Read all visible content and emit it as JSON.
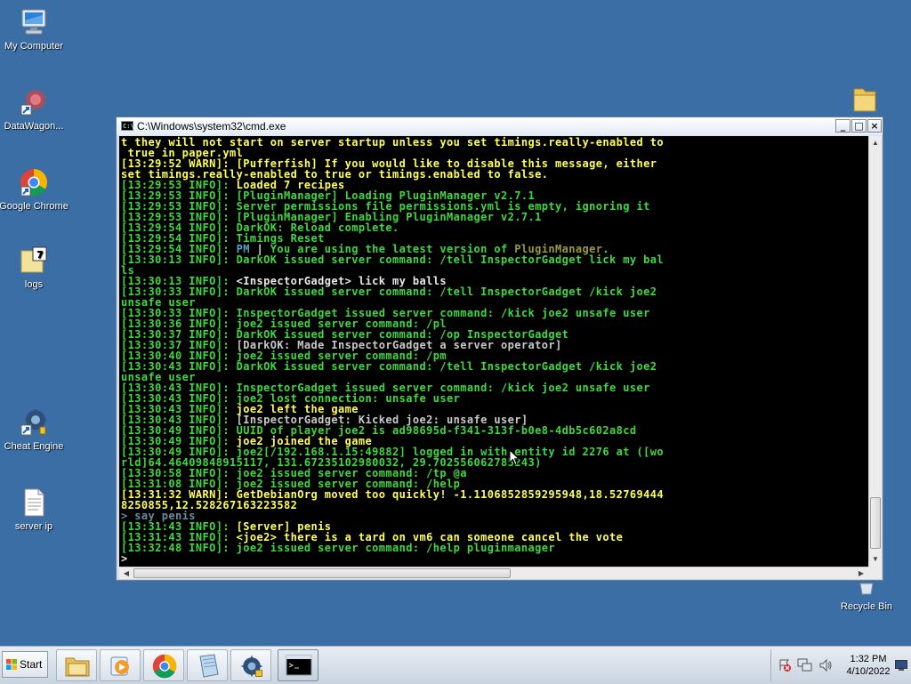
{
  "desktop": {
    "icons": [
      {
        "label": "My Computer",
        "icon": "computer-icon"
      },
      {
        "label": "DataWagon...",
        "icon": "shortcut-icon"
      },
      {
        "label": "Google Chrome",
        "icon": "chrome-icon"
      },
      {
        "label": "logs",
        "icon": "notepad-file-icon"
      },
      {
        "label": "Cheat Engine",
        "icon": "cheat-engine-icon"
      },
      {
        "label": "server ip",
        "icon": "text-file-icon"
      },
      {
        "label": "Recycle Bin",
        "icon": "recycle-bin-icon"
      },
      {
        "label": "",
        "icon": "folder-icon"
      }
    ]
  },
  "window": {
    "title": "C:\\Windows\\system32\\cmd.exe",
    "appicon_text": "C:\\",
    "minimize": "_",
    "maximize": "□",
    "close": "×"
  },
  "console": {
    "lines": [
      [
        {
          "t": "t they will not start on server startup unless you set timings.really-enabled to",
          "c": "y"
        }
      ],
      [
        {
          "t": " true in paper.yml",
          "c": "y"
        }
      ],
      [
        {
          "t": "[13:29:52 WARN]: [Pufferfish] If you would like to disable this message, either",
          "c": "y"
        }
      ],
      [
        {
          "t": "set timings.really-enabled to true or timings.enabled to false.",
          "c": "y"
        }
      ],
      [
        {
          "t": "[13:29:53 INFO]: ",
          "c": "g"
        },
        {
          "t": "Loaded 7 recipes",
          "c": "y"
        }
      ],
      [
        {
          "t": "[13:29:53 INFO]: [PluginManager] Loading PluginManager v2.7.1",
          "c": "g"
        }
      ],
      [
        {
          "t": "[13:29:53 INFO]: Server permissions file permissions.yml is empty, ignoring it",
          "c": "g"
        }
      ],
      [
        {
          "t": "[13:29:53 INFO]: [PluginManager] Enabling PluginManager v2.7.1",
          "c": "g"
        }
      ],
      [
        {
          "t": "[13:29:54 INFO]: DarkOK: Reload complete.",
          "c": "g"
        }
      ],
      [
        {
          "t": "[13:29:54 INFO]: Timings Reset",
          "c": "g"
        }
      ],
      [
        {
          "t": "[13:29:54 INFO]: ",
          "c": "g"
        },
        {
          "t": "PM",
          "c": "b"
        },
        {
          "t": " | ",
          "c": "w"
        },
        {
          "t": "You are using the latest version of ",
          "c": "g"
        },
        {
          "t": "PluginManager",
          "c": "o"
        },
        {
          "t": ".",
          "c": "g"
        }
      ],
      [
        {
          "t": "[13:30:13 INFO]: DarkOK issued server command: /tell InspectorGadget lick my bal",
          "c": "g"
        }
      ],
      [
        {
          "t": "ls",
          "c": "g"
        }
      ],
      [
        {
          "t": "[13:30:13 INFO]: ",
          "c": "g"
        },
        {
          "t": "<InspectorGadget> lick my balls",
          "c": "w"
        }
      ],
      [
        {
          "t": "[13:30:33 INFO]: DarkOK issued server command: /tell InspectorGadget /kick joe2",
          "c": "g"
        }
      ],
      [
        {
          "t": "unsafe user",
          "c": "g"
        }
      ],
      [
        {
          "t": "[13:30:33 INFO]: InspectorGadget issued server command: /kick joe2 unsafe user",
          "c": "g"
        }
      ],
      [
        {
          "t": "[13:30:36 INFO]: joe2 issued server command: /pl",
          "c": "g"
        }
      ],
      [
        {
          "t": "[13:30:37 INFO]: DarkOK issued server command: /op InspectorGadget",
          "c": "g"
        }
      ],
      [
        {
          "t": "[13:30:37 INFO]: ",
          "c": "g"
        },
        {
          "t": "[DarkOK: Made InspectorGadget a server operator]",
          "c": "d"
        }
      ],
      [
        {
          "t": "[13:30:40 INFO]: joe2 issued server command: /pm",
          "c": "g"
        }
      ],
      [
        {
          "t": "[13:30:43 INFO]: DarkOK issued server command: /tell InspectorGadget /kick joe2",
          "c": "g"
        }
      ],
      [
        {
          "t": "unsafe user",
          "c": "g"
        }
      ],
      [
        {
          "t": "[13:30:43 INFO]: InspectorGadget issued server command: /kick joe2 unsafe user",
          "c": "g"
        }
      ],
      [
        {
          "t": "[13:30:43 INFO]: joe2 lost connection: unsafe user",
          "c": "g"
        }
      ],
      [
        {
          "t": "[13:30:43 INFO]: ",
          "c": "g"
        },
        {
          "t": "joe2 left the game",
          "c": "y"
        }
      ],
      [
        {
          "t": "[13:30:43 INFO]: ",
          "c": "g"
        },
        {
          "t": "[InspectorGadget: Kicked joe2: unsafe user]",
          "c": "d"
        }
      ],
      [
        {
          "t": "[13:30:49 INFO]: UUID of player joe2 is ad98695d-f341-313f-b0e8-4db5c602a8cd",
          "c": "g"
        }
      ],
      [
        {
          "t": "[13:30:49 INFO]: ",
          "c": "g"
        },
        {
          "t": "joe2 joined the game",
          "c": "y"
        }
      ],
      [
        {
          "t": "[13:30:49 INFO]: joe2[/192.168.1.15:49882] logged in with entity id 2276 at ([wo",
          "c": "g"
        }
      ],
      [
        {
          "t": "rld]64.46409848915117, 131.67235102980032, 29.702556062785243)",
          "c": "g"
        }
      ],
      [
        {
          "t": "[13:30:58 INFO]: joe2 issued server command: /tp @a",
          "c": "g"
        }
      ],
      [
        {
          "t": "[13:31:08 INFO]: joe2 issued server command: /help",
          "c": "g"
        }
      ],
      [
        {
          "t": "[13:31:32 WARN]: GetDebianOrg moved too quickly! -1.1106852859295948,18.52769444",
          "c": "y"
        }
      ],
      [
        {
          "t": "8250855,12.528267163223582",
          "c": "y"
        }
      ],
      [
        {
          "t": "> say penis",
          "c": "s"
        }
      ],
      [
        {
          "t": "[13:31:43 INFO]: ",
          "c": "g"
        },
        {
          "t": "[Server] penis",
          "c": "y"
        }
      ],
      [
        {
          "t": "[13:31:43 INFO]: ",
          "c": "g"
        },
        {
          "t": "<joe2> there is a tard on vm6 can someone cancel the vote",
          "c": "y"
        }
      ],
      [
        {
          "t": "[13:32:48 INFO]: joe2 issued server command: /help pluginmanager",
          "c": "g"
        }
      ],
      [
        {
          "t": ">",
          "c": "w"
        }
      ]
    ]
  },
  "taskbar": {
    "start_label": "Start",
    "buttons": [
      {
        "name": "explorer-taskbar-button",
        "icon": "folder-icon"
      },
      {
        "name": "media-player-taskbar-button",
        "icon": "media-player-icon"
      },
      {
        "name": "chrome-taskbar-button",
        "icon": "chrome-icon"
      },
      {
        "name": "notepad-taskbar-button",
        "icon": "notepad-icon"
      },
      {
        "name": "cheat-engine-taskbar-button",
        "icon": "cheat-engine-icon"
      },
      {
        "name": "cmd-taskbar-button",
        "icon": "cmd-icon",
        "active": true
      }
    ],
    "tray_icons": [
      "action-center-icon",
      "network-icon",
      "volume-icon"
    ],
    "clock_time": "1:32 PM",
    "clock_date": "4/10/2022"
  },
  "colors": {
    "desktop_bg": "#3b6ea5",
    "console_green": "#3fd93f",
    "console_yellow": "#ffff55",
    "console_white": "#e8e8e8"
  }
}
